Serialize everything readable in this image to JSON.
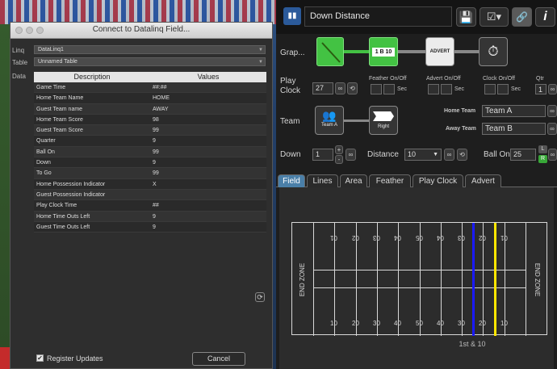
{
  "dialog": {
    "title": "Connect to Datalinq Field...",
    "linq_label": "Linq",
    "linq_value": "DataLinq1",
    "table_label": "Table",
    "table_value": "Unnamed Table",
    "data_label": "Data",
    "columns": [
      "Description",
      "Values"
    ],
    "rows": [
      [
        "Game Time",
        "##:##"
      ],
      [
        "Home Team Name",
        "HOME"
      ],
      [
        "Guest Team name",
        "AWAY"
      ],
      [
        "Home Team Score",
        "98"
      ],
      [
        "Guest Team Score",
        "99"
      ],
      [
        "Quarter",
        "9"
      ],
      [
        "Ball On",
        "99"
      ],
      [
        "Down",
        "9"
      ],
      [
        "To Go",
        "99"
      ],
      [
        "Home Possession Indicator",
        "X"
      ],
      [
        "Guest Possession Indicator",
        ""
      ],
      [
        "Play Clock Time",
        "##"
      ],
      [
        "Home Time Outs Left",
        "9"
      ],
      [
        "Guest Time Outs Left",
        "9"
      ]
    ],
    "register_updates_label": "Register Updates",
    "register_updates_checked": true,
    "cancel_label": "Cancel"
  },
  "panel": {
    "title": "Down Distance",
    "graphic_label": "Grap...",
    "play_clock_label": "Play\nClock",
    "play_clock_value": "27",
    "feather_label": "Feather On/Off",
    "advert_label": "Advert On/Off",
    "clock_label": "Clock On/Off",
    "qtr_label": "Qtr",
    "qtr_value": "1",
    "sec_label": "Sec",
    "team_label": "Team",
    "home_team_label": "Home Team",
    "home_team_value": "Team A",
    "away_team_label": "Away Team",
    "away_team_value": "Team B",
    "team_node_label": "Team A",
    "right_node_label": "Right",
    "node_1b10": "1 B 10",
    "node_advert": "ADVERT",
    "down_label": "Down",
    "down_value": "1",
    "distance_label": "Distance",
    "distance_value": "10",
    "ball_on_label": "Ball On",
    "ball_on_value": "25",
    "l_label": "L",
    "r_label": "R",
    "tabs": [
      "Field",
      "Lines",
      "Area",
      "Feather",
      "Play Clock",
      "Advert"
    ],
    "active_tab": "Field",
    "end_zone_left": "END ZONE",
    "end_zone_right": "END ZONE",
    "yard_numbers_top": [
      "01",
      "02",
      "03",
      "04",
      "05",
      "04",
      "03",
      "02",
      "01"
    ],
    "yard_numbers_bottom": [
      "10",
      "20",
      "30",
      "40",
      "50",
      "40",
      "30",
      "20",
      "10"
    ],
    "scrimmage_line_color": "#1a1aff",
    "first_down_line_color": "#ffe600",
    "field_caption": "1st & 10"
  }
}
